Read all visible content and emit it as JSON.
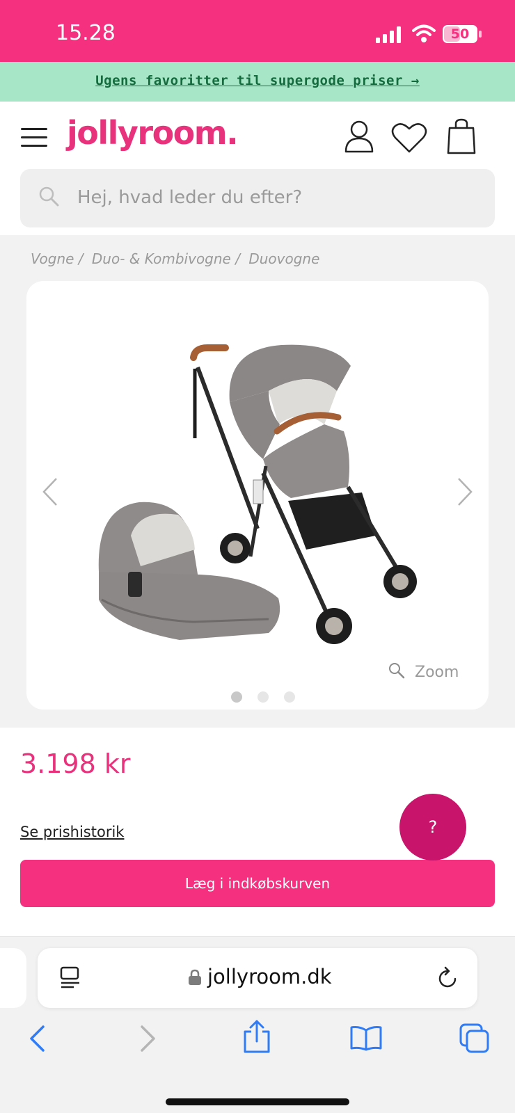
{
  "status_bar": {
    "time": "15.28",
    "battery": "50",
    "battery_level": 0.5,
    "color": "#f4307f"
  },
  "promo": {
    "text": "Ugens favoritter til supergode priser →"
  },
  "header": {
    "logo": "jollyroom.",
    "brand_color": "#e8327c"
  },
  "search": {
    "placeholder": "Hej, hvad leder du efter?"
  },
  "breadcrumb": [
    "Vogne /",
    "Duo- & Kombivogne /",
    "Duovogne"
  ],
  "gallery": {
    "zoom_label": "Zoom",
    "active_index": 0,
    "count": 3
  },
  "product": {
    "price": "3.198 kr",
    "price_history_label": "Se prishistorik",
    "add_to_cart_label": "Læg i indkøbskurven",
    "help_label": "?"
  },
  "browser": {
    "url": "jollyroom.dk"
  },
  "icons": [
    "menu-icon",
    "account-icon",
    "heart-icon",
    "bag-icon",
    "search-icon",
    "chevron-left-icon",
    "chevron-right-icon",
    "zoom-icon",
    "reader-icon",
    "lock-icon",
    "reload-icon",
    "back-icon",
    "forward-icon",
    "share-icon",
    "bookmarks-icon",
    "tabs-icon"
  ]
}
